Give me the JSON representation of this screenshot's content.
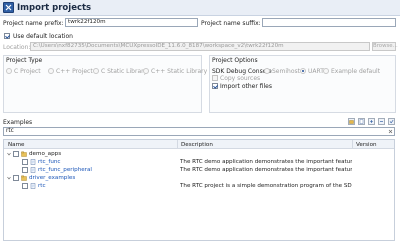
{
  "window": {
    "title": "Import projects"
  },
  "project": {
    "prefix_label": "Project name prefix:",
    "prefix_value": "twrk22f120m",
    "suffix_label": "Project name suffix:",
    "suffix_value": ""
  },
  "location": {
    "use_default_label": "Use default location",
    "use_default_checked": true,
    "label": "Location:",
    "value": "C:\\Users\\nxf82735\\Documents\\MCUXpressoIDE_11.6.0_8187\\workspace_v2\\twrk22f120m",
    "browse_label": "Browse..."
  },
  "project_type": {
    "title": "Project Type",
    "options": [
      "C Project",
      "C++ Project",
      "C Static Library",
      "C++ Static Library"
    ]
  },
  "project_options": {
    "title": "Project Options",
    "sdk_debug_label": "SDK Debug Console",
    "console_options": [
      "Semihost",
      "UART",
      "Example default"
    ],
    "console_selected": "UART",
    "copy_sources_label": "Copy sources",
    "import_other_label": "Import other files",
    "import_other_checked": true
  },
  "examples": {
    "title": "Examples",
    "filter_value": "rtc",
    "columns": {
      "name": "Name",
      "description": "Description",
      "version": "Version"
    },
    "rows": [
      {
        "name": "demo_apps",
        "level": 0,
        "expanded": true,
        "description": ""
      },
      {
        "name": "rtc_func",
        "level": 1,
        "description": "The RTC demo application demonstrates the important features of the ..."
      },
      {
        "name": "rtc_func_peripheral",
        "level": 1,
        "description": "The RTC demo application demonstrates the important features of the ..."
      },
      {
        "name": "driver_examples",
        "level": 0,
        "expanded": true,
        "description": ""
      },
      {
        "name": "rtc",
        "level": 1,
        "description": "The RTC project is a simple demonstration program of the SDK RTC driv..."
      }
    ]
  },
  "colors": {
    "accent": "#1f4f9a",
    "link": "#1a55b8",
    "header_bg": "#e9eef6"
  },
  "icons": [
    "import-projects-icon",
    "folder-icon",
    "project-file-icon",
    "expand-all-icon",
    "collapse-all-icon",
    "select-all-icon",
    "deselect-icon"
  ]
}
